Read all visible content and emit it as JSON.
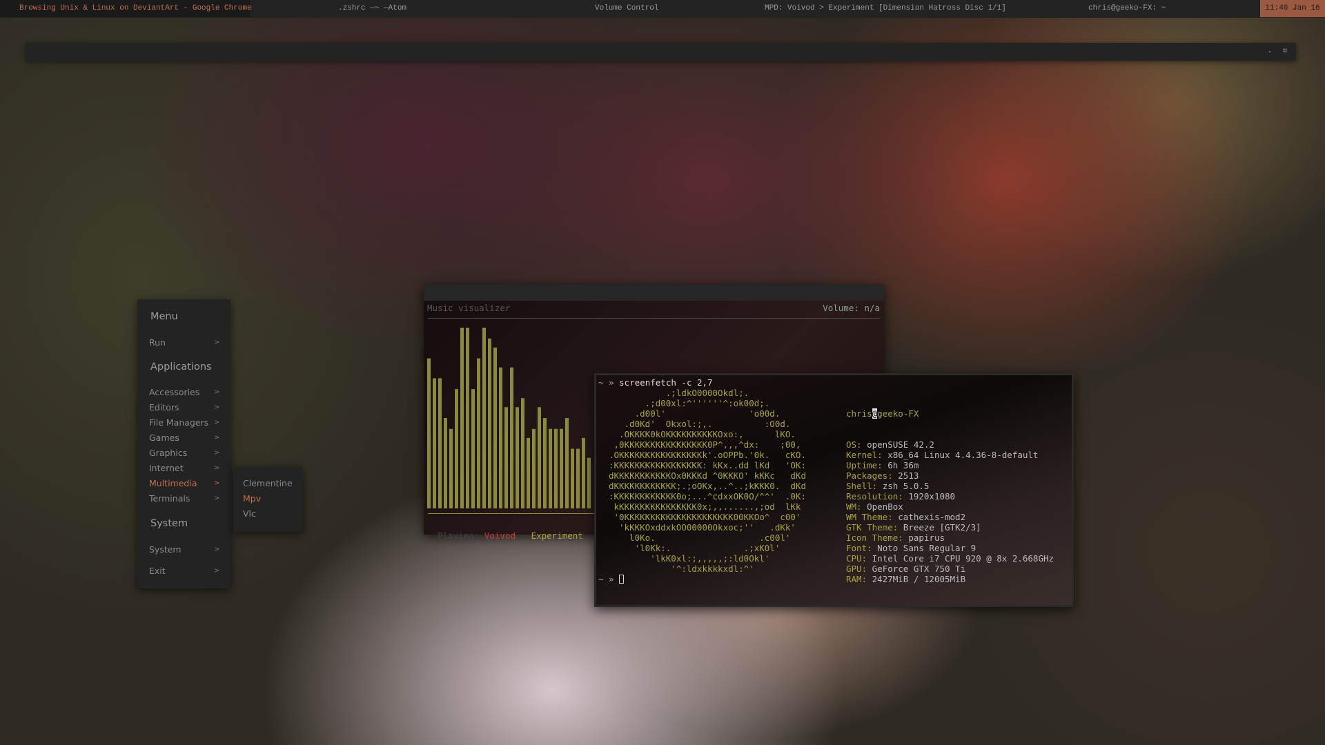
{
  "taskbar": {
    "items": [
      {
        "label": "Browsing Unix & Linux on DeviantArt - Google Chrome",
        "active": true
      },
      {
        "label": ".zshrc —~ —Atom"
      },
      {
        "label": "Volume Control"
      },
      {
        "label": "MPD: Voivod > Experiment [Dimension Hatross Disc 1/1]"
      },
      {
        "label": "chris@geeko-FX: ~"
      }
    ],
    "clock": "11:40 Jan 16"
  },
  "colors": {
    "accent": "#c0704a",
    "clock_bg": "#9b5a40",
    "art": "#a8a33a",
    "bars": "#8a8c3a",
    "artist": "#c04040"
  },
  "menu": {
    "title": "Menu",
    "run": "Run",
    "applications_header": "Applications",
    "apps": [
      "Accessories",
      "Editors",
      "File Managers",
      "Games",
      "Graphics",
      "Internet",
      "Multimedia",
      "Terminals"
    ],
    "selected": "Multimedia",
    "system_header": "System",
    "system": "System",
    "exit": "Exit",
    "arrow": ">"
  },
  "submenu": {
    "items": [
      "Clementine",
      "Mpv",
      "Vlc"
    ],
    "selected": "Mpv"
  },
  "visualizer": {
    "title": "Music visualizer",
    "volume": "Volume: n/a",
    "playing_label": "Playing:",
    "artist": "Voivod",
    "separator": "·",
    "album": "Experiment",
    "levels": [
      0.83,
      0.72,
      0.72,
      0.5,
      0.44,
      0.66,
      1.0,
      1.0,
      0.66,
      0.83,
      1.0,
      0.94,
      0.89,
      0.78,
      0.56,
      0.78,
      0.56,
      0.61,
      0.39,
      0.44,
      0.56,
      0.5,
      0.44,
      0.44,
      0.44,
      0.5,
      0.33,
      0.33,
      0.39,
      0.28
    ]
  },
  "terminal": {
    "prompt": "~ »",
    "command": "screenfetch -c 2,7",
    "art": [
      "           .;ldkO0000Okdl;.",
      "       .;d00xl:^''''''^:ok00d;.",
      "     .d00l'                'o00d.",
      "   .d0Kd'  Okxol:;,.          :O0d.",
      "  .OKKKK0kOKKKKKKKKKKOxo:,      lKO.",
      " ,0KKKKKKKKKKKKKKKK0P^,,,^dx:    ;00,",
      ".OKKKKKKKKKKKKKKKKk'.oOPPb.'0k.   cKO.",
      ":KKKKKKKKKKKKKKKKK: kKx..dd lKd   'OK:",
      "dKKKKKKKKKKKOx0KKKd ^0KKKO' kKKc   dKd",
      "dKKKKKKKKKKKK;.;oOKx,..^..;kKKK0.  dKd",
      ":KKKKKKKKKKKK0o;...^cdxxOK0O/^^'  .0K:",
      " kKKKKKKKKKKKKKKK0x;,,......,;od  lKk",
      " '0KKKKKKKKKKKKKKKKKKKKK00KKOo^  c00'",
      "  'kKKKOxddxkOO00000Okxoc;''   .dKk'",
      "    l0Ko.                    .c00l'",
      "     'l0Kk:.              .;xK0l'",
      "        'lkK0xl:;,,,,,;:ld0Okl'",
      "            '^:ldxkkkkxdl:^'"
    ],
    "user": "chris",
    "at": "@",
    "host": "geeko-FX",
    "info": [
      [
        "OS:",
        "openSUSE 42.2"
      ],
      [
        "Kernel:",
        "x86_64 Linux 4.4.36-8-default"
      ],
      [
        "Uptime:",
        "6h 36m"
      ],
      [
        "Packages:",
        "2513"
      ],
      [
        "Shell:",
        "zsh 5.0.5"
      ],
      [
        "Resolution:",
        "1920x1080"
      ],
      [
        "WM:",
        "OpenBox"
      ],
      [
        "WM Theme:",
        "cathexis-mod2"
      ],
      [
        "GTK Theme:",
        "Breeze [GTK2/3]"
      ],
      [
        "Icon Theme:",
        "papirus"
      ],
      [
        "Font:",
        "Noto Sans Regular 9"
      ],
      [
        "CPU:",
        "Intel Core i7 CPU 920 @ 8x 2.668GHz"
      ],
      [
        "GPU:",
        "GeForce GTX 750 Ti"
      ],
      [
        "RAM:",
        "2427MiB / 12005MiB"
      ]
    ]
  }
}
